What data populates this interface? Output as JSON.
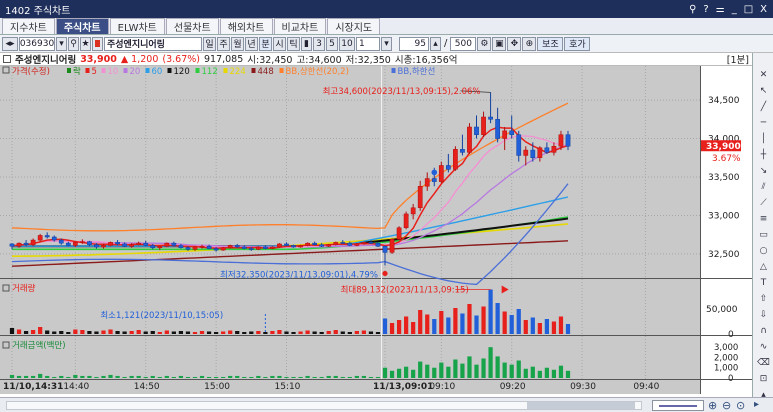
{
  "window": {
    "title": "1402 주식차트",
    "controls": [
      "⚲",
      "?",
      "⚌",
      "_",
      "□",
      "X"
    ]
  },
  "tabs": [
    "지수차트",
    "주식차트",
    "ELW차트",
    "선물차트",
    "해외차트",
    "비교차트",
    "시장지도"
  ],
  "toolbar": {
    "code": "036930",
    "name": "주성엔지니어링",
    "periods": [
      "일",
      "주",
      "월",
      "년",
      "분",
      "시",
      "틱"
    ],
    "intervals": [
      "3",
      "5",
      "10"
    ],
    "interval_value": "1",
    "count_value": "95",
    "total_value": "500",
    "view_button": "보조",
    "quote_button": "호가"
  },
  "infobar": {
    "name": "주성엔지니어링",
    "price": "33,900",
    "change": "▲ 1,200",
    "rate": "(3.67%)",
    "volume": "917,085",
    "open": "시:32,450",
    "high": "고:34,600",
    "low": "저:32,350",
    "cap": "시총:16,356억",
    "unit": "[1분]"
  },
  "colors": {
    "up": "#e8201c",
    "down": "#2160d8",
    "bg": "#c9c9c9",
    "title": "#1f2f5c"
  },
  "legend": [
    {
      "text": "가격(수정)",
      "color": "#d0241e"
    },
    {
      "text": "락",
      "color": "#1a8a1a"
    },
    {
      "text": "5",
      "color": "#e8201c"
    },
    {
      "text": "10",
      "color": "#f58fd3"
    },
    {
      "text": "20",
      "color": "#b878e0"
    },
    {
      "text": "60",
      "color": "#2b9fe8"
    },
    {
      "text": "120",
      "color": "#111111"
    },
    {
      "text": "112",
      "color": "#2ecc40"
    },
    {
      "text": "224",
      "color": "#e6d800"
    },
    {
      "text": "448",
      "color": "#8b1a1a"
    },
    {
      "text": "BB,상한선(20,2)",
      "color": "#ff7f2a"
    },
    {
      "text": "BB,하한선",
      "color": "#4a6fd8"
    }
  ],
  "annotations": {
    "high": "최고34,600(2023/11/13,09:15),2.06%",
    "low": "최저32,350(2023/11/13,09:01),4.79%",
    "vol_max": "최대89,132(2023/11/13,09:15)",
    "vol_min": "최소1,121(2023/11/10,15:05)"
  },
  "price_axis": [
    "34,500",
    "34,000",
    "33,500",
    "33,000",
    "32,500"
  ],
  "price_tag": "33,900",
  "rate_tag": "3.67%",
  "volume_panel": {
    "title": "거래량",
    "axis": [
      "50,000",
      "0"
    ]
  },
  "amount_panel": {
    "title": "거래금액(백만)",
    "axis": [
      "3,000",
      "2,000",
      "1,000",
      "0"
    ]
  },
  "time_axis": [
    "11/10,14:31",
    "14:40",
    "14:50",
    "15:00",
    "15:10",
    "11/13,09:01",
    "09:10",
    "09:20",
    "09:30",
    "09:40"
  ],
  "chart_data": {
    "type": "candlestick",
    "candles": [
      [
        32630,
        32640,
        32560,
        32600
      ],
      [
        32600,
        32650,
        32580,
        32640
      ],
      [
        32640,
        32680,
        32600,
        32620
      ],
      [
        32620,
        32700,
        32600,
        32680
      ],
      [
        32680,
        32760,
        32660,
        32740
      ],
      [
        32740,
        32780,
        32700,
        32720
      ],
      [
        32720,
        32740,
        32660,
        32680
      ],
      [
        32680,
        32700,
        32620,
        32640
      ],
      [
        32640,
        32660,
        32600,
        32610
      ],
      [
        32610,
        32660,
        32590,
        32650
      ],
      [
        32650,
        32690,
        32630,
        32660
      ],
      [
        32660,
        32670,
        32600,
        32620
      ],
      [
        32620,
        32640,
        32570,
        32590
      ],
      [
        32590,
        32630,
        32570,
        32610
      ],
      [
        32610,
        32660,
        32600,
        32650
      ],
      [
        32650,
        32680,
        32610,
        32630
      ],
      [
        32630,
        32650,
        32590,
        32600
      ],
      [
        32600,
        32640,
        32580,
        32620
      ],
      [
        32620,
        32660,
        32610,
        32640
      ],
      [
        32640,
        32670,
        32600,
        32610
      ],
      [
        32610,
        32630,
        32560,
        32580
      ],
      [
        32580,
        32610,
        32550,
        32600
      ],
      [
        32600,
        32650,
        32590,
        32640
      ],
      [
        32640,
        32660,
        32600,
        32610
      ],
      [
        32610,
        32630,
        32570,
        32580
      ],
      [
        32580,
        32600,
        32540,
        32560
      ],
      [
        32560,
        32600,
        32540,
        32590
      ],
      [
        32590,
        32620,
        32570,
        32600
      ],
      [
        32600,
        32620,
        32560,
        32570
      ],
      [
        32570,
        32590,
        32530,
        32550
      ],
      [
        32550,
        32590,
        32540,
        32580
      ],
      [
        32580,
        32620,
        32570,
        32610
      ],
      [
        32610,
        32630,
        32580,
        32590
      ],
      [
        32590,
        32610,
        32560,
        32570
      ],
      [
        32570,
        32590,
        32540,
        32560
      ],
      [
        32560,
        32600,
        32550,
        32590
      ],
      [
        32590,
        32610,
        32560,
        32570
      ],
      [
        32570,
        32600,
        32560,
        32590
      ],
      [
        32590,
        32640,
        32580,
        32630
      ],
      [
        32630,
        32650,
        32600,
        32610
      ],
      [
        32610,
        32620,
        32580,
        32590
      ],
      [
        32590,
        32620,
        32580,
        32610
      ],
      [
        32610,
        32650,
        32600,
        32640
      ],
      [
        32640,
        32660,
        32610,
        32620
      ],
      [
        32620,
        32640,
        32590,
        32600
      ],
      [
        32600,
        32630,
        32590,
        32620
      ],
      [
        32620,
        32660,
        32610,
        32650
      ],
      [
        32650,
        32680,
        32630,
        32640
      ],
      [
        32640,
        32660,
        32600,
        32610
      ],
      [
        32610,
        32640,
        32600,
        32630
      ],
      [
        32630,
        32660,
        32620,
        32650
      ],
      [
        32650,
        32680,
        32630,
        32640
      ],
      [
        32640,
        32650,
        32590,
        32600
      ],
      [
        32600,
        32610,
        32350,
        32520
      ],
      [
        32520,
        32700,
        32500,
        32690
      ],
      [
        32690,
        32860,
        32680,
        32840
      ],
      [
        32840,
        33050,
        32820,
        33020
      ],
      [
        33020,
        33150,
        32950,
        33100
      ],
      [
        33100,
        33450,
        33060,
        33380
      ],
      [
        33380,
        33560,
        33320,
        33480
      ],
      [
        33480,
        33620,
        33380,
        33440
      ],
      [
        33440,
        33700,
        33420,
        33650
      ],
      [
        33650,
        33800,
        33560,
        33600
      ],
      [
        33600,
        33900,
        33580,
        33860
      ],
      [
        33860,
        34050,
        33780,
        33820
      ],
      [
        33820,
        34200,
        33800,
        34150
      ],
      [
        34150,
        34300,
        34000,
        34050
      ],
      [
        34050,
        34350,
        34020,
        34280
      ],
      [
        34280,
        34600,
        34200,
        34250
      ],
      [
        34250,
        34400,
        33950,
        34000
      ],
      [
        34000,
        34150,
        33850,
        34100
      ],
      [
        34100,
        34300,
        34000,
        34050
      ],
      [
        34050,
        34100,
        33700,
        33780
      ],
      [
        33780,
        33900,
        33650,
        33850
      ],
      [
        33850,
        33950,
        33700,
        33750
      ],
      [
        33750,
        33900,
        33700,
        33880
      ],
      [
        33880,
        33950,
        33800,
        33820
      ],
      [
        33820,
        33950,
        33780,
        33900
      ],
      [
        33900,
        34100,
        33850,
        34050
      ],
      [
        34050,
        34100,
        33850,
        33900
      ]
    ],
    "volume": [
      12,
      9,
      6,
      8,
      14,
      7,
      5,
      6,
      4,
      9,
      8,
      6,
      5,
      7,
      9,
      6,
      5,
      6,
      8,
      5,
      6,
      4,
      7,
      5,
      6,
      5,
      4,
      6,
      5,
      4,
      5,
      7,
      6,
      4,
      5,
      6,
      4,
      6,
      8,
      5,
      4,
      5,
      7,
      5,
      4,
      6,
      8,
      5,
      4,
      6,
      7,
      5,
      4,
      31,
      22,
      28,
      35,
      24,
      48,
      39,
      30,
      46,
      33,
      52,
      41,
      60,
      37,
      55,
      89,
      62,
      45,
      38,
      50,
      28,
      33,
      22,
      30,
      25,
      35,
      20
    ],
    "amount": [
      3,
      2,
      2,
      2,
      4,
      2,
      1,
      2,
      1,
      3,
      2,
      2,
      1,
      2,
      3,
      2,
      1,
      2,
      2,
      1,
      2,
      1,
      2,
      1,
      2,
      1,
      1,
      2,
      1,
      1,
      1,
      2,
      2,
      1,
      1,
      2,
      1,
      2,
      2,
      1,
      1,
      1,
      2,
      1,
      1,
      2,
      2,
      1,
      1,
      2,
      2,
      1,
      1,
      10,
      7,
      9,
      11,
      8,
      16,
      13,
      10,
      15,
      11,
      18,
      14,
      21,
      13,
      19,
      30,
      21,
      15,
      13,
      17,
      9,
      11,
      7,
      10,
      8,
      12,
      7
    ]
  }
}
